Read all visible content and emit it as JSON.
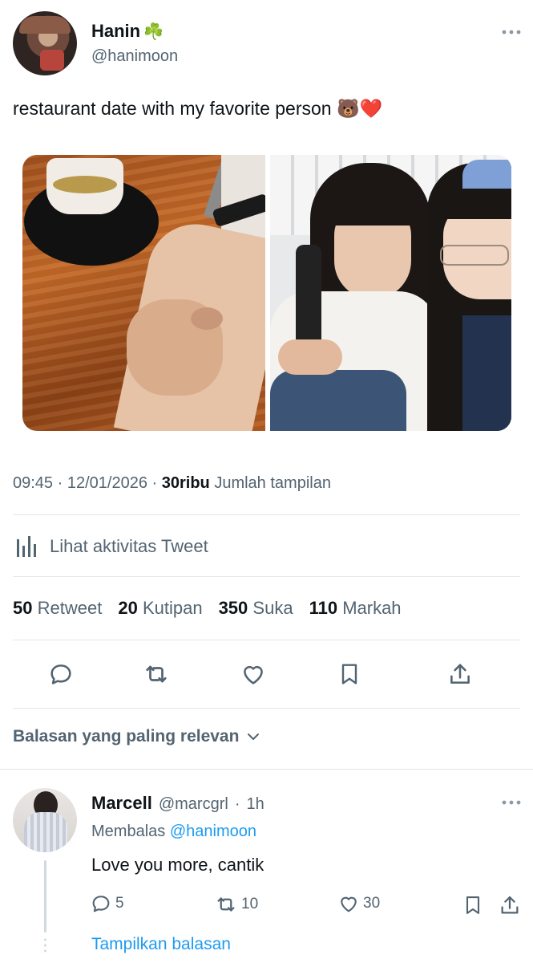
{
  "tweet": {
    "author_name": "Hanin",
    "author_emoji": "☘️",
    "author_handle": "@hanimoon",
    "text": "restaurant date with my favorite person 🐻❤️",
    "time": "09:45",
    "date": "12/01/2026",
    "views_count": "30ribu",
    "views_label": "Jumlah tampilan",
    "activity_label": "Lihat aktivitas Tweet",
    "stats": [
      {
        "count": "50",
        "label": "Retweet"
      },
      {
        "count": "20",
        "label": "Kutipan"
      },
      {
        "count": "350",
        "label": "Suka"
      },
      {
        "count": "110",
        "label": "Markah"
      }
    ]
  },
  "replies_sort_label": "Balasan yang paling relevan",
  "reply": {
    "author_name": "Marcell",
    "author_handle": "@marcgrl",
    "time": "1h",
    "replying_prefix": "Membalas",
    "replying_to": "@hanimoon",
    "text": "Love you more, cantik",
    "reply_count": "5",
    "retweet_count": "10",
    "like_count": "30",
    "show_replies_label": "Tampilkan balasan"
  },
  "colors": {
    "accent": "#1d9bf0",
    "text": "#0f1419",
    "muted": "#536471",
    "divider": "#e1e6ea"
  }
}
